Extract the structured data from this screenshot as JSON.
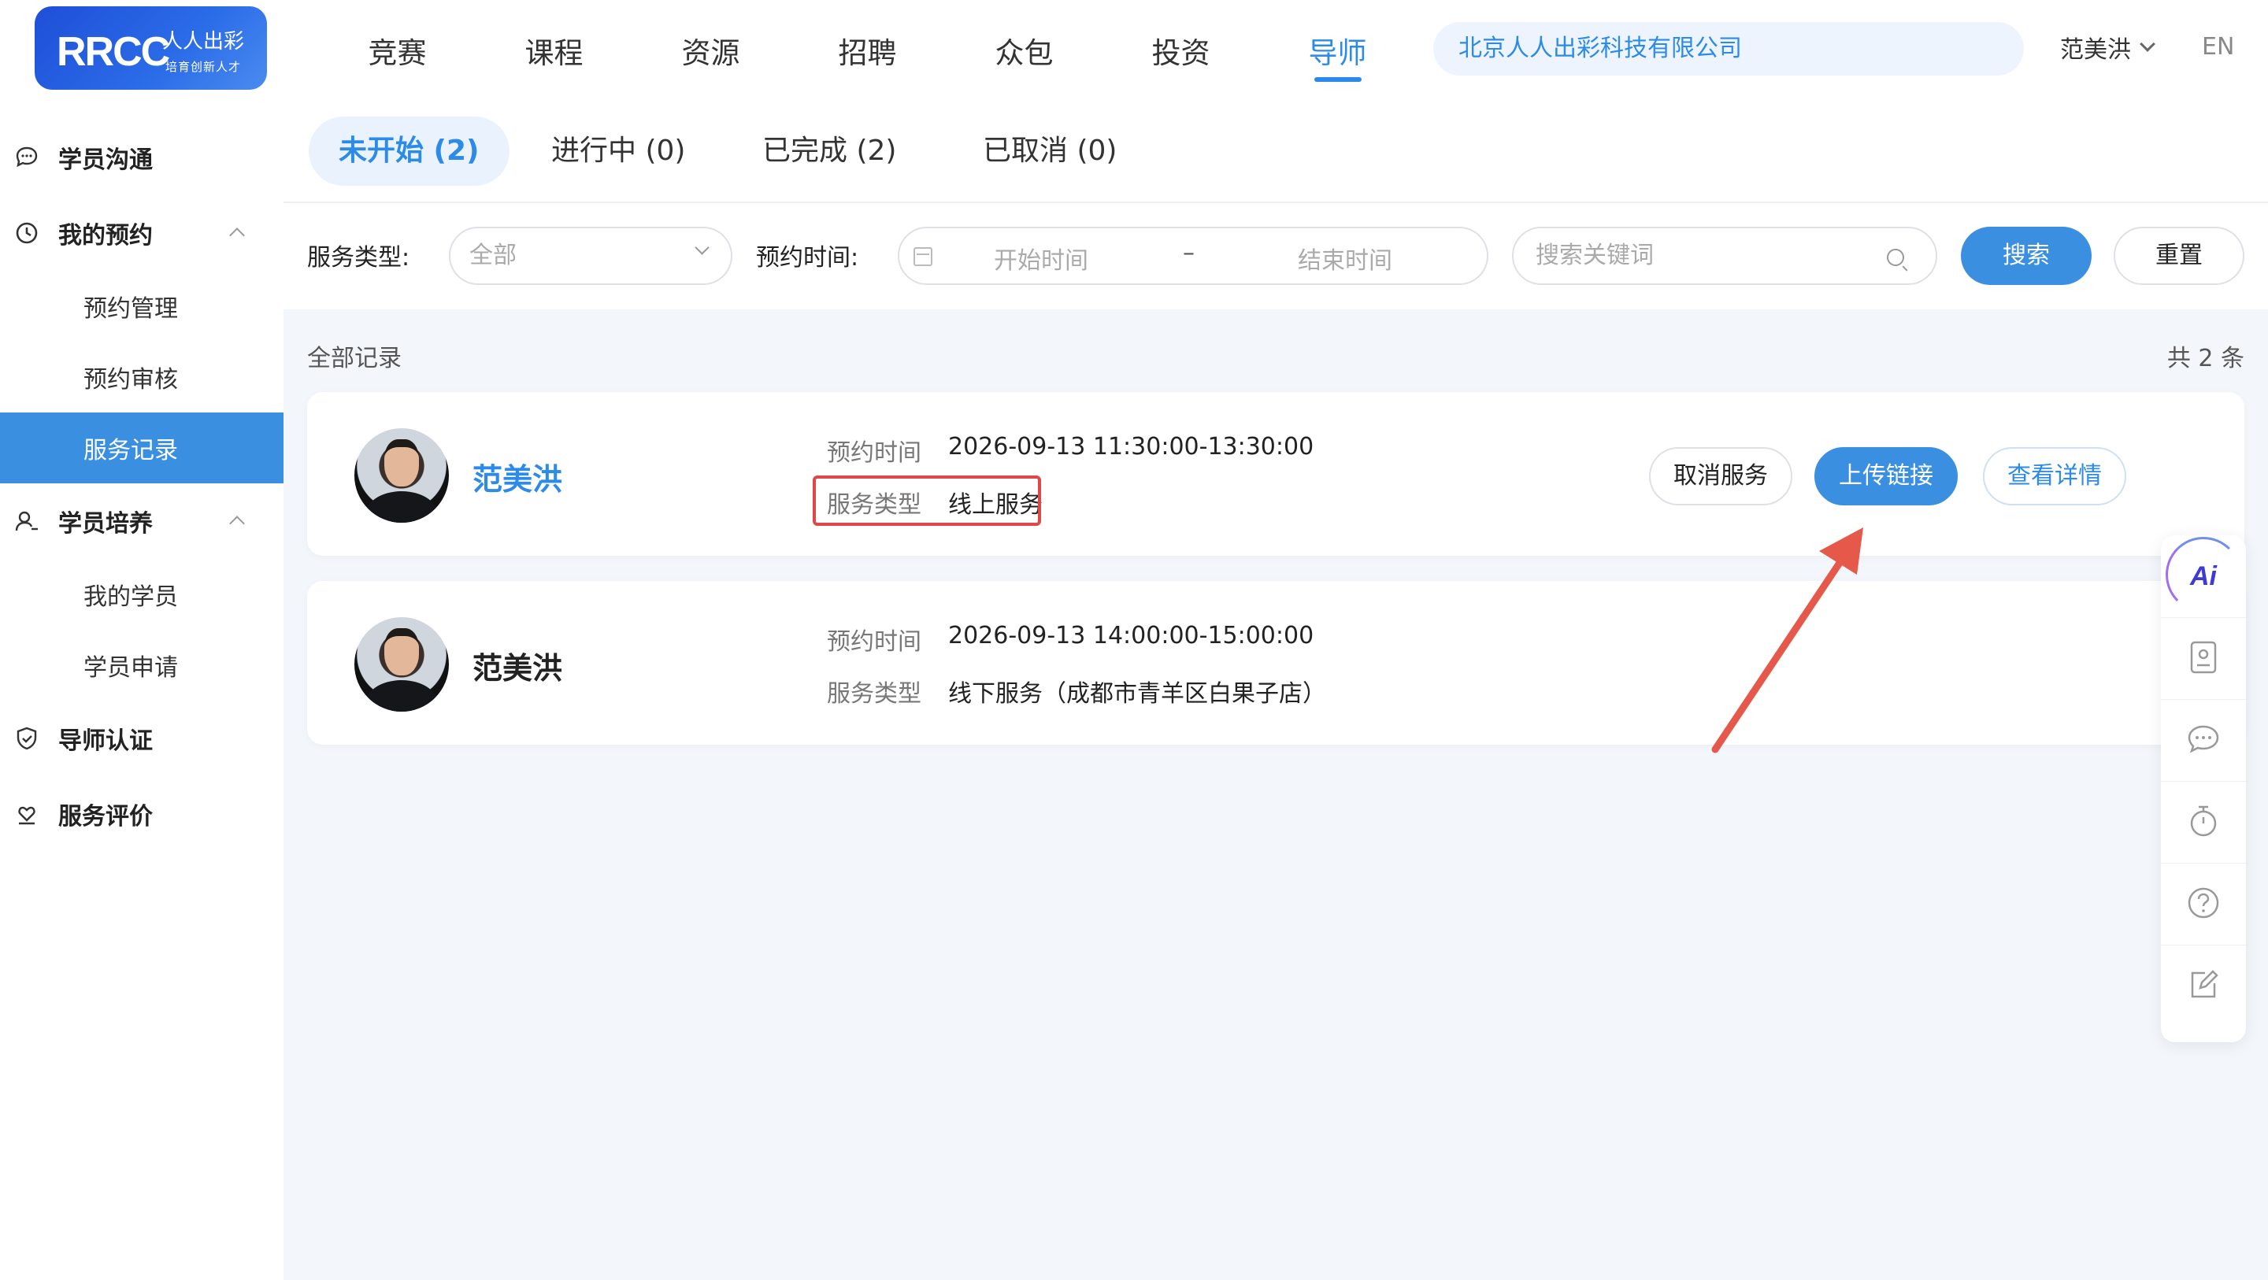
{
  "brand": {
    "logo_main": "RRCC",
    "logo_cn": "人人出彩",
    "logo_sub": "培育创新人才"
  },
  "nav": [
    {
      "label": "竞赛",
      "active": false
    },
    {
      "label": "课程",
      "active": false
    },
    {
      "label": "资源",
      "active": false
    },
    {
      "label": "招聘",
      "active": false
    },
    {
      "label": "众包",
      "active": false
    },
    {
      "label": "投资",
      "active": false
    },
    {
      "label": "导师",
      "active": true
    }
  ],
  "header": {
    "company": "北京人人出彩科技有限公司",
    "user": "范美洪",
    "lang": "EN"
  },
  "sidebar": {
    "items": [
      {
        "label": "学员沟通",
        "icon": "chat-bubble-icon"
      },
      {
        "label": "我的预约",
        "icon": "clock-icon"
      },
      {
        "label": "预约管理"
      },
      {
        "label": "预约审核"
      },
      {
        "label": "服务记录",
        "active": true
      },
      {
        "label": "学员培养",
        "icon": "user-icon"
      },
      {
        "label": "我的学员"
      },
      {
        "label": "学员申请"
      },
      {
        "label": "导师认证",
        "icon": "shield-check-icon"
      },
      {
        "label": "服务评价",
        "icon": "heart-hand-icon"
      }
    ]
  },
  "tabs": [
    {
      "label": "未开始 (2)",
      "active": true
    },
    {
      "label": "进行中 (0)",
      "active": false
    },
    {
      "label": "已完成 (2)",
      "active": false
    },
    {
      "label": "已取消 (0)",
      "active": false
    }
  ],
  "filter": {
    "service_type_label": "服务类型:",
    "service_type_value": "全部",
    "time_label": "预约时间:",
    "start_placeholder": "开始时间",
    "dash": "–",
    "end_placeholder": "结束时间",
    "keyword_placeholder": "搜索关键词",
    "search_btn": "搜索",
    "reset_btn": "重置"
  },
  "records": {
    "title": "全部记录",
    "count": "共 2 条",
    "items": [
      {
        "name": "范美洪",
        "time_label": "预约时间",
        "time": "2026-09-13 11:30:00-13:30:00",
        "type_label": "服务类型",
        "type": "线上服务",
        "actions": {
          "cancel": "取消服务",
          "upload": "上传链接",
          "detail": "查看详情"
        }
      },
      {
        "name": "范美洪",
        "time_label": "预约时间",
        "time": "2026-09-13 14:00:00-15:00:00",
        "type_label": "服务类型",
        "type": "线下服务（成都市青羊区白果子店）"
      }
    ]
  },
  "floatbar": {
    "ai_label": "Ai",
    "icons": [
      "ai-icon",
      "contact-card-icon",
      "chat-dots-icon",
      "timer-icon",
      "help-circle-icon",
      "edit-icon"
    ]
  },
  "colors": {
    "accent": "#3b8fe0",
    "highlight": "#e04848",
    "arrow": "#e6584a"
  }
}
